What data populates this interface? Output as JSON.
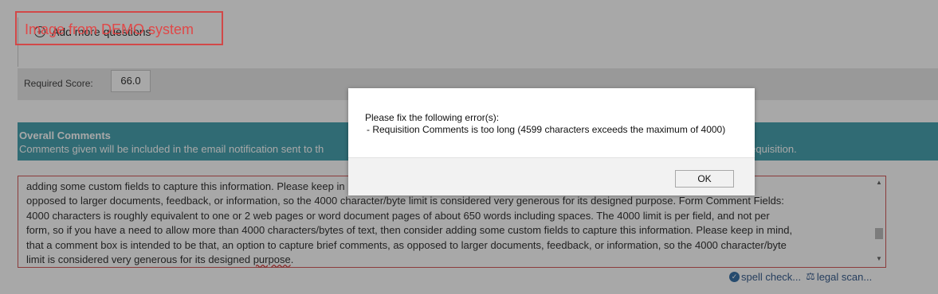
{
  "top": {
    "add_questions": "Add more questions"
  },
  "required_score": {
    "label": "Required Score:",
    "value": "66.0"
  },
  "overall_comments": {
    "title": "Overall Comments",
    "subtitle": "Comments given will be included in the email notification sent to th",
    "subtitle_tail": "button at the top of each requisition.",
    "text_lines": [
      "adding some custom fields to capture this information. Please keep in mind, that a comment box is intended to be that, an option to capture brief comments, as",
      "opposed to larger documents, feedback, or information, so the 4000 character/byte limit is considered very generous for its designed purpose. Form Comment Fields:",
      "4000 characters is roughly equivalent to one or 2 web pages or word document pages of about 650 words including spaces. The 4000 limit is per field, and not per",
      "form, so if you have a need to allow more than 4000 characters/bytes of text, then consider adding some custom fields to capture this information. Please keep in mind,",
      "that a comment box is intended to be that, an option to capture brief comments, as opposed to larger documents, feedback, or information, so the 4000 character/byte"
    ],
    "last_line_prefix": "limit is considered very generous for its designed ",
    "last_line_word": "purpose",
    "last_line_suffix": "."
  },
  "tools": {
    "spell_check": "spell check...",
    "legal_scan": "legal scan..."
  },
  "demo_label": "Image from DEMO system",
  "modal": {
    "heading": "Please fix the following error(s):",
    "error": " - Requisition Comments is too long (4599 characters exceeds the maximum of 4000)",
    "ok": "OK"
  },
  "colors": {
    "header": "#4aa3b1",
    "error_border": "#d45a5a",
    "demo_red": "#e04848"
  }
}
